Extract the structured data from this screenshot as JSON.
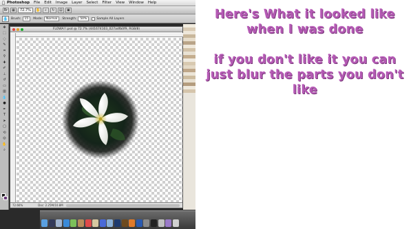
{
  "menubar": {
    "apple": "",
    "app_name": "Photoshop",
    "items": [
      "File",
      "Edit",
      "Image",
      "Layer",
      "Select",
      "Filter",
      "View",
      "Window",
      "Help"
    ]
  },
  "appbar": {
    "zoom": "72.7%"
  },
  "options": {
    "brush_label": "Brush:",
    "brush_size": "15",
    "mode_label": "Mode:",
    "mode_value": "Normal",
    "strength_label": "Strength:",
    "strength_value": "50%",
    "sample_all_layers": "Sample All Layers"
  },
  "document": {
    "title": "FLOWA!!.psd @ 72.7% (441674103_027adfb0f9, RGB/8)",
    "zoom": "72.66%",
    "status": "Doc: 2.25M/10.8M"
  },
  "caption": {
    "line1": "Here's What it looked like",
    "line2": "when I was done",
    "line3": "if you don't like it you can",
    "line4": "just blur the parts you don't",
    "line5": "like"
  },
  "colors": {
    "caption": "#b45ab4",
    "foreground_swatch": "#1a1a1a",
    "background_swatch": "#6a3c7a"
  }
}
